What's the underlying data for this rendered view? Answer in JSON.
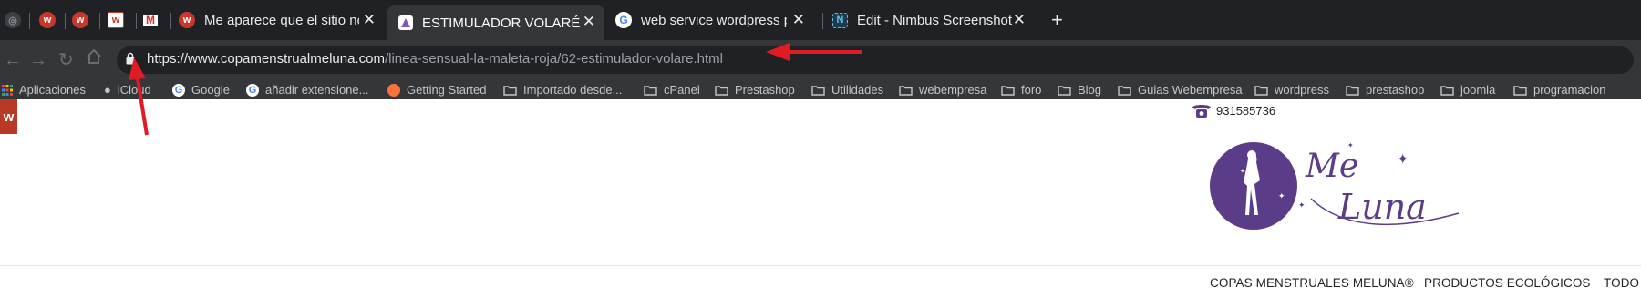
{
  "tabs": [
    {
      "favicon": "webempresa-icon",
      "title": ""
    },
    {
      "favicon": "webempresa-icon",
      "title": ""
    },
    {
      "favicon": "webempresa-icon",
      "title": ""
    },
    {
      "favicon": "gmail-icon",
      "title": ""
    },
    {
      "favicon": "webempresa-icon",
      "title": "Me aparece que el sitio no es s"
    },
    {
      "favicon": "meluna-icon",
      "title": "ESTIMULADOR VOLARÉ - Proc",
      "active": true
    },
    {
      "favicon": "google-icon",
      "title": "web service wordpress plugin"
    },
    {
      "favicon": "nimbus-icon",
      "title": "Edit - Nimbus Screenshot"
    }
  ],
  "new_tab_label": "+",
  "close_glyph": "✕",
  "address": {
    "scheme": "https://",
    "host": "www.copamenstrualmeluna.com",
    "path": "/linea-sensual-la-maleta-roja/62-estimulador-volare.html"
  },
  "bookmarks": [
    {
      "icon": "apps-grid-icon",
      "label": "Aplicaciones"
    },
    {
      "icon": "apple-icon",
      "label": "iCloud"
    },
    {
      "icon": "google-icon",
      "label": "Google"
    },
    {
      "icon": "google-icon",
      "label": "añadir extensione..."
    },
    {
      "icon": "firefox-icon",
      "label": "Getting Started"
    },
    {
      "icon": "folder-icon",
      "label": "Importado desde..."
    },
    {
      "icon": "folder-icon",
      "label": "cPanel"
    },
    {
      "icon": "folder-icon",
      "label": "Prestashop"
    },
    {
      "icon": "folder-icon",
      "label": "Utilidades"
    },
    {
      "icon": "folder-icon",
      "label": "webempresa"
    },
    {
      "icon": "folder-icon",
      "label": "foro"
    },
    {
      "icon": "folder-icon",
      "label": "Blog"
    },
    {
      "icon": "folder-icon",
      "label": "Guias Webempresa"
    },
    {
      "icon": "folder-icon",
      "label": "wordpress"
    },
    {
      "icon": "folder-icon",
      "label": "prestashop"
    },
    {
      "icon": "folder-icon",
      "label": "joomla"
    },
    {
      "icon": "folder-icon",
      "label": "programacion"
    }
  ],
  "page": {
    "badge_letter": "w",
    "phone": "931585736",
    "logo_text_line1": "Me",
    "logo_text_line2": "Luna",
    "nav": [
      "COPAS MENSTRUALES MELUNA®",
      "PRODUCTOS ECOLÓGICOS",
      "TODO"
    ]
  },
  "colors": {
    "tab_strip": "#202124",
    "toolbar": "#35363a",
    "brand_purple": "#5b3c88",
    "annotation_red": "#e01b24",
    "webempresa_red": "#c9372c"
  }
}
